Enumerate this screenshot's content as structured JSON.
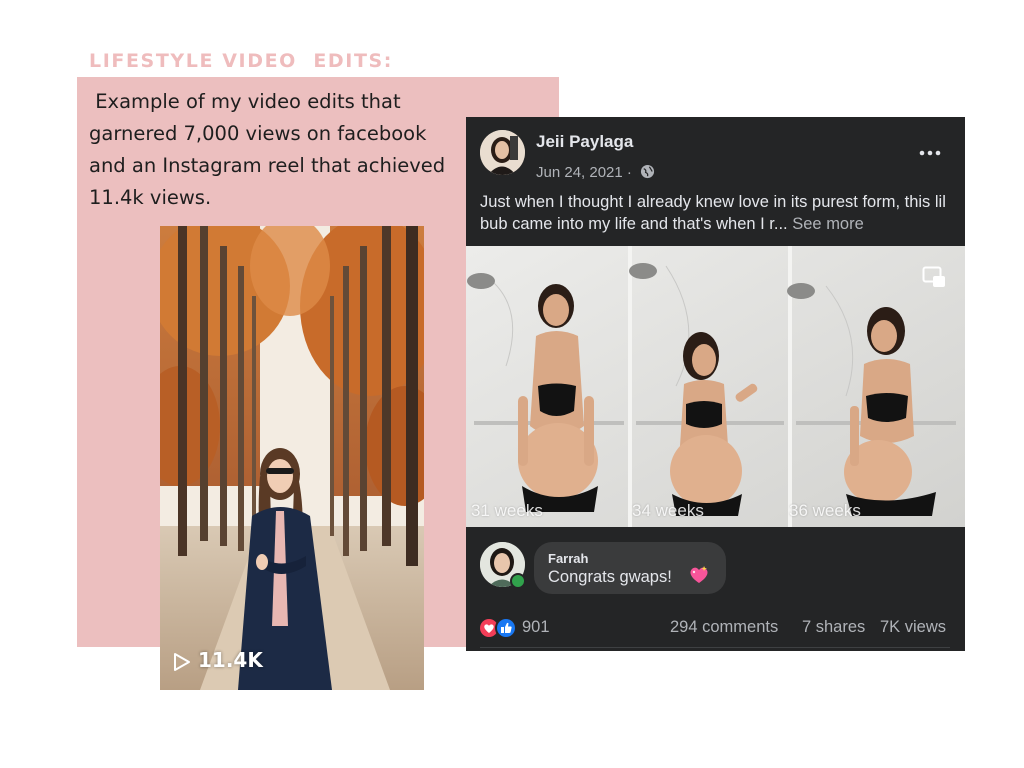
{
  "heading": "LIFESTYLE VIDEO  EDITS:",
  "description": " Example of my video edits that garnered 7,000 views on facebook and an Instagram reel that achieved 11.4k views.",
  "reel": {
    "views": "11.4K",
    "icon": "play-icon"
  },
  "facebook_post": {
    "author": "Jeii Paylaga",
    "date": "Jun 24, 2021 ·",
    "privacy_icon": "globe-icon",
    "menu_icon": "more-dots-icon",
    "text": "Just when I thought I already knew love in its purest form, this lil bub came into my life and that's when I r...",
    "see_more": "See more",
    "video": {
      "labels": [
        "31 weeks",
        "34 weeks",
        "36 weeks"
      ],
      "pip_icon": "picture-in-picture-icon"
    },
    "comment": {
      "author": "Farrah",
      "text": "Congrats gwaps!",
      "emoji": "sparkling-heart-icon"
    },
    "reactions": {
      "count": "901",
      "icons": [
        "love-reaction-icon",
        "like-reaction-icon"
      ]
    },
    "stats": {
      "comments": "294 comments",
      "shares": "7 shares",
      "views": "7K views"
    }
  },
  "colors": {
    "heading": "#efbcbd",
    "panel": "#ecbfbf",
    "fb_background": "#242526",
    "fb_text": "#e4e6eb",
    "fb_secondary": "#b0b3b8",
    "bubble": "#3a3b3c",
    "like": "#1877f2",
    "love": "#f33e58",
    "online": "#31a24c"
  }
}
